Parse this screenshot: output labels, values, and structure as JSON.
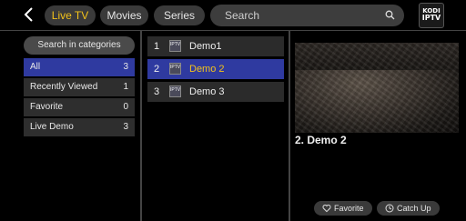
{
  "header": {
    "tabs": [
      {
        "label": "Live TV",
        "active": true
      },
      {
        "label": "Movies",
        "active": false
      },
      {
        "label": "Series",
        "active": false
      }
    ],
    "search_placeholder": "Search",
    "logo_text": [
      "KODI",
      "IPTV"
    ]
  },
  "categories": {
    "search_label": "Search in categories",
    "items": [
      {
        "label": "All",
        "count": "3",
        "selected": true
      },
      {
        "label": "Recently Viewed",
        "count": "1",
        "selected": false
      },
      {
        "label": "Favorite",
        "count": "0",
        "selected": false
      },
      {
        "label": "Live Demo",
        "count": "3",
        "selected": false
      }
    ]
  },
  "channels": [
    {
      "num": "1",
      "name": "Demo1",
      "selected": false
    },
    {
      "num": "2",
      "name": "Demo 2",
      "selected": true
    },
    {
      "num": "3",
      "name": "Demo 3",
      "selected": false
    }
  ],
  "player": {
    "now_playing": "2.  Demo 2",
    "favorite_label": "Favorite",
    "catchup_label": "Catch Up"
  },
  "colors": {
    "accent": "#f2c21b",
    "selection": "#2f3aa0",
    "panel": "#2e2e2e"
  }
}
